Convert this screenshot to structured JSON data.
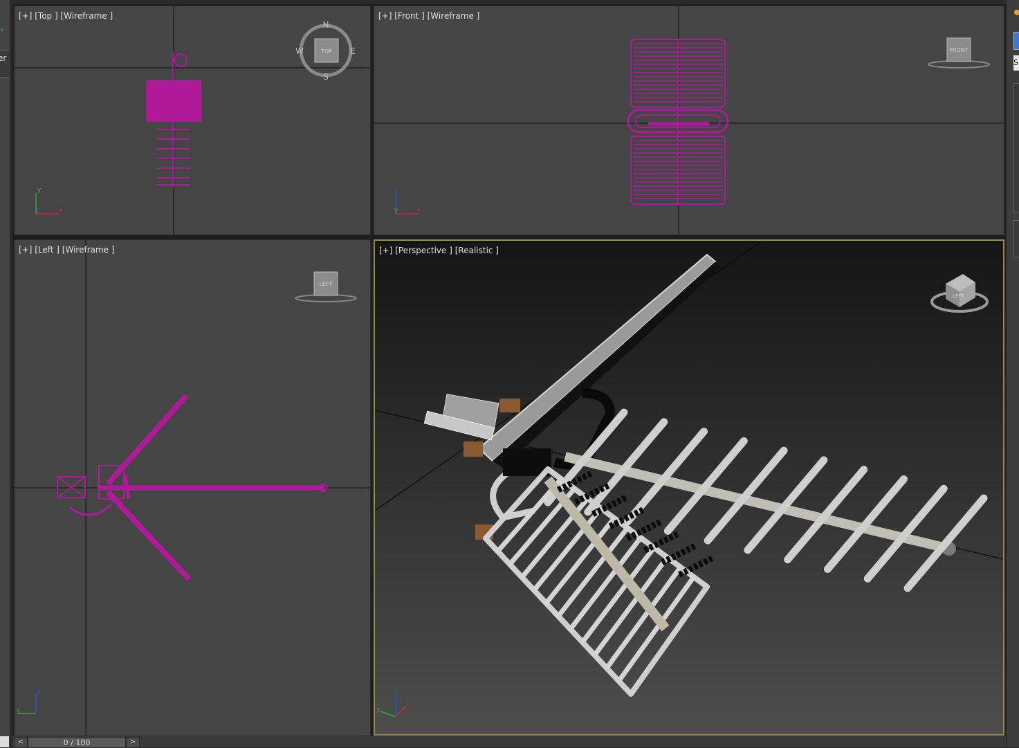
{
  "viewports": {
    "top": {
      "label": "[+] [Top ] [Wireframe ]"
    },
    "front": {
      "label": "[+] [Front ] [Wireframe ]"
    },
    "left": {
      "label": "[+] [Left ] [Wireframe ]"
    },
    "perspective": {
      "label": "[+] [Perspective ] [Realistic ]"
    }
  },
  "compass": {
    "n": "N",
    "s": "S",
    "e": "E",
    "w": "W"
  },
  "viewcube": {
    "top": "TOP",
    "front": "FRONT",
    "left": "LEFT"
  },
  "axes": {
    "x": "x",
    "y": "y",
    "z": "z"
  },
  "left_panel": {
    "chevron": "»",
    "fragment": "er"
  },
  "right_panel": {
    "fragment": "S"
  },
  "timeline": {
    "prev": "<",
    "next": ">",
    "frame": "0 / 100"
  },
  "colors": {
    "wire": "#b01a9a",
    "active_border": "#9b8a4b",
    "viewport_bg": "#454545"
  }
}
